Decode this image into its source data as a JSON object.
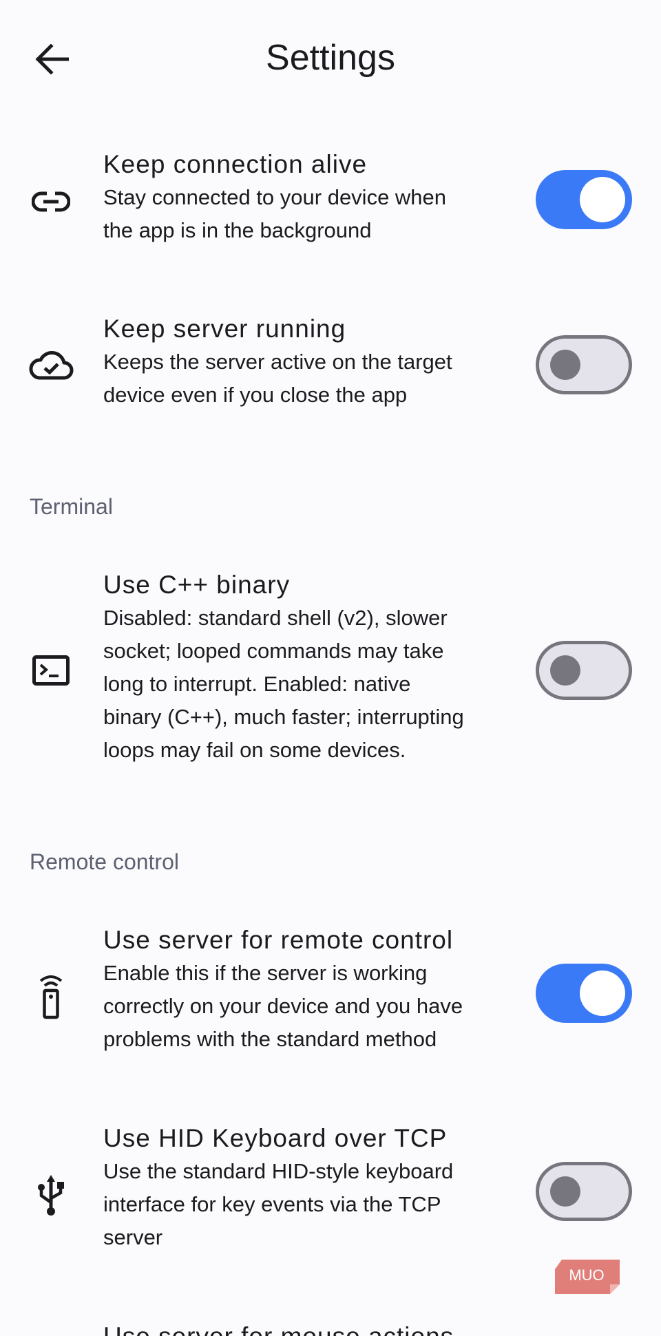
{
  "header": {
    "title": "Settings",
    "back_icon": "arrow-left-icon"
  },
  "colors": {
    "accent": "#3b7af6",
    "background": "#fbfbfe",
    "section_text": "#5c6070",
    "switch_off_track": "#e4e3ec",
    "switch_off_outline": "#77767f"
  },
  "general": {
    "items": [
      {
        "icon": "link-icon",
        "title": "Keep connection alive",
        "description_lines": [
          "Stay connected to your device when",
          "the app is in the background"
        ],
        "enabled": true
      },
      {
        "icon": "cloud-check-icon",
        "title": "Keep server running",
        "description_lines": [
          "Keeps the server active on the target",
          "device even if you close the app"
        ],
        "enabled": false
      }
    ]
  },
  "terminal": {
    "section_label": "Terminal",
    "items": [
      {
        "icon": "terminal-icon",
        "title": "Use C++ binary",
        "description_lines": [
          "Disabled: standard shell (v2), slower",
          "socket; looped commands may take",
          "long to interrupt. Enabled: native",
          "binary (C++), much faster; interrupting",
          "loops may fail on some devices."
        ],
        "enabled": false
      }
    ]
  },
  "remote_control": {
    "section_label": "Remote control",
    "items": [
      {
        "icon": "remote-icon",
        "title": "Use server for remote control",
        "description_lines": [
          "Enable this if the server is working",
          "correctly on your device and you have",
          "problems with the standard method"
        ],
        "enabled": true
      },
      {
        "icon": "usb-icon",
        "title": "Use HID Keyboard over TCP",
        "description_lines": [
          "Use the standard HID-style keyboard",
          "interface for key events via the TCP",
          "server"
        ],
        "enabled": false
      },
      {
        "title": "Use server for mouse actions"
      }
    ]
  },
  "watermark": {
    "text": "MUO"
  }
}
